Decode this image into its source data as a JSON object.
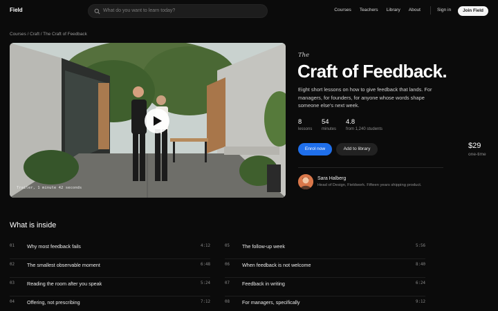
{
  "nav": {
    "logo": "Field",
    "search_placeholder": "What do you want to learn today?",
    "links": [
      "Courses",
      "Teachers",
      "Library",
      "About"
    ],
    "signin": "Sign in",
    "join": "Join Field"
  },
  "breadcrumb": "Courses / Craft / The Craft of Feedback",
  "hero": {
    "trailer_label": "Trailer, 1 minute 42 seconds"
  },
  "course": {
    "kicker": "The",
    "title": "Craft of Feedback.",
    "description": "Eight short lessons on how to give feedback that lands. For managers, for founders, for anyone whose words shape someone else's next week.",
    "stats": [
      {
        "value": "8",
        "label": "lessons"
      },
      {
        "value": "54",
        "label": "minutes"
      },
      {
        "value": "4.8",
        "label": "from 1,240 students"
      }
    ],
    "enrol_label": "Enrol now",
    "library_label": "Add to library",
    "price": "$29",
    "price_note": "one-time",
    "author_name": "Sara Halberg",
    "author_bio": "Head of Design, Fieldwork. Fifteen years shipping product."
  },
  "syllabus": {
    "title": "What is inside",
    "lessons": [
      {
        "num": "01",
        "title": "Why most feedback fails",
        "duration": "4:12"
      },
      {
        "num": "02",
        "title": "The smallest observable moment",
        "duration": "6:48"
      },
      {
        "num": "03",
        "title": "Reading the room after you speak",
        "duration": "5:24"
      },
      {
        "num": "04",
        "title": "Offering, not prescribing",
        "duration": "7:12"
      },
      {
        "num": "05",
        "title": "The follow-up week",
        "duration": "5:56"
      },
      {
        "num": "06",
        "title": "When feedback is not welcome",
        "duration": "8:40"
      },
      {
        "num": "07",
        "title": "Feedback in writing",
        "duration": "6:24"
      },
      {
        "num": "08",
        "title": "For managers, specifically",
        "duration": "9:12"
      }
    ]
  },
  "colors": {
    "accent": "#1f6feb",
    "background": "#0b0b0b"
  }
}
